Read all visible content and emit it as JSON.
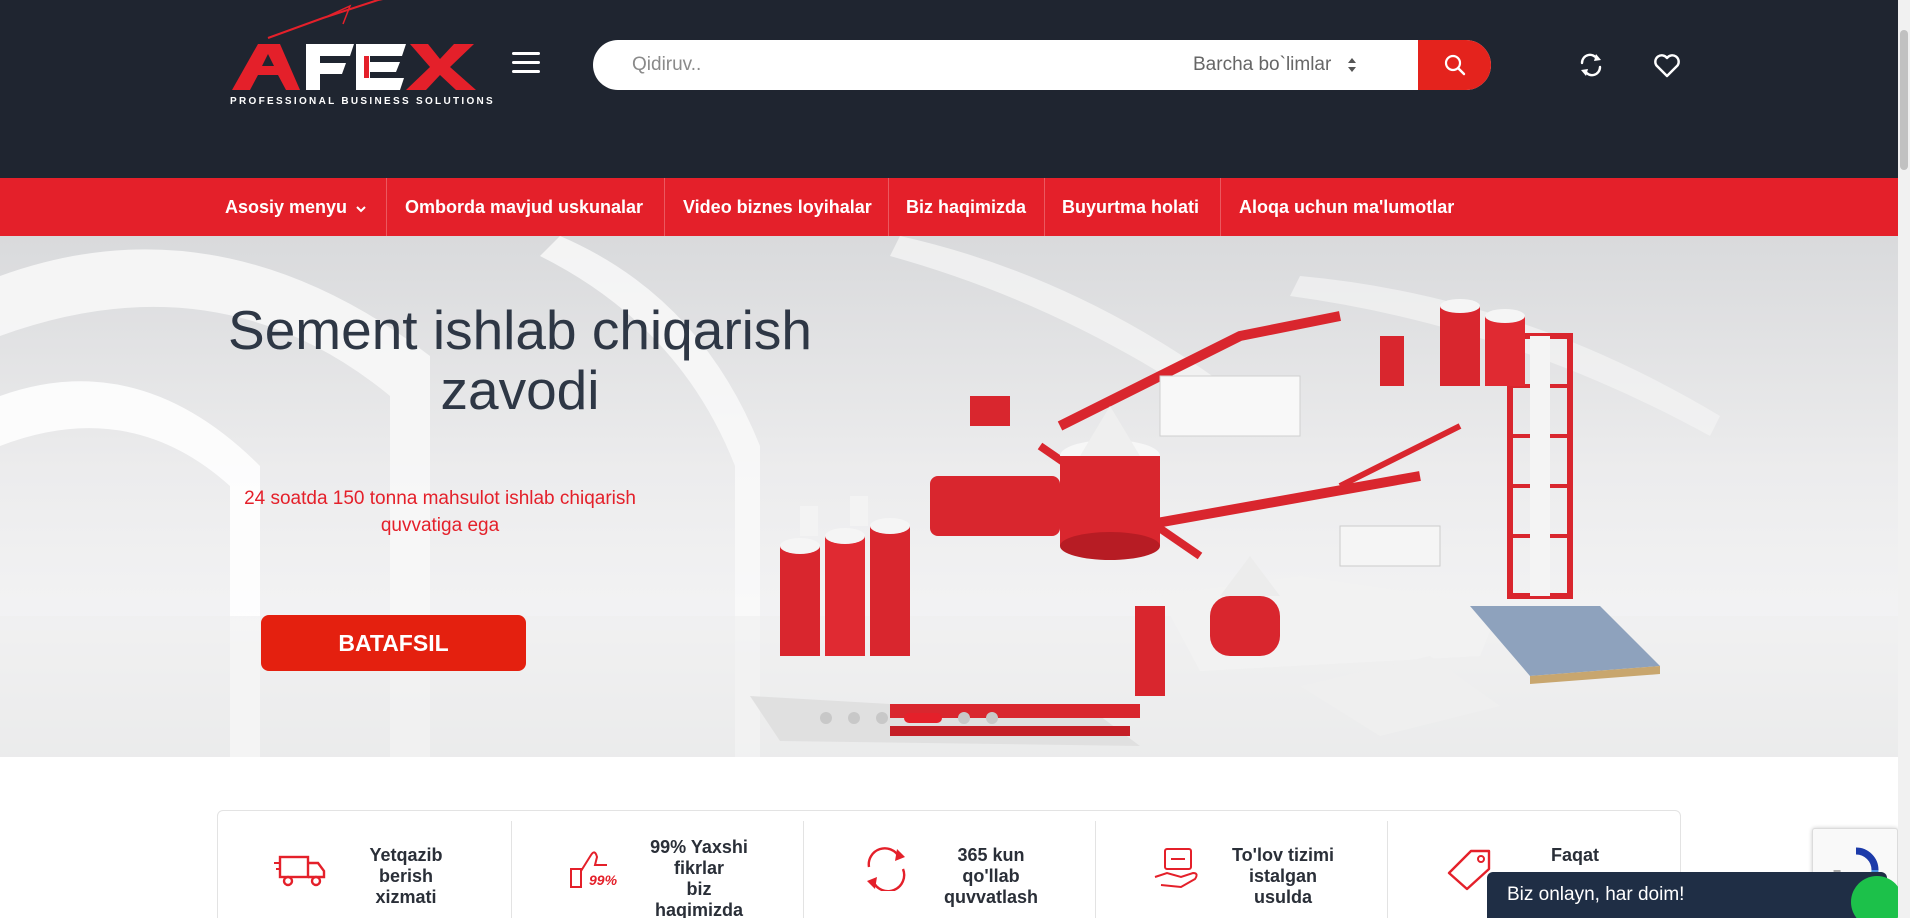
{
  "header": {
    "logo_text": "AFEX",
    "logo_tagline": "PROFESSIONAL BUSINESS SOLUTIONS",
    "search_placeholder": "Qidiruv..",
    "category_select": "Barcha bo`limlar",
    "icons": [
      "menu-icon",
      "search-icon",
      "compare-icon",
      "heart-icon"
    ]
  },
  "nav": {
    "items": [
      {
        "label": "Asosiy menyu",
        "has_dropdown": true
      },
      {
        "label": "Omborda mavjud uskunalar"
      },
      {
        "label": "Video biznes loyihalar"
      },
      {
        "label": "Biz haqimizda"
      },
      {
        "label": "Buyurtma holati"
      },
      {
        "label": "Aloqa uchun ma'lumotlar"
      }
    ]
  },
  "hero": {
    "title_line1": "Sement ishlab chiqarish",
    "title_line2": "zavodi",
    "subtitle_line1": "24 soatda 150 tonna mahsulot ishlab chiqarish",
    "subtitle_line2": "quvvatiga ega",
    "button": "BATAFSIL",
    "slides_count": 6,
    "active_slide": 4
  },
  "features": [
    {
      "icon": "delivery-truck-icon",
      "lines": [
        "Yetqazib",
        "berish",
        "xizmati"
      ]
    },
    {
      "icon": "thumbs-up-icon",
      "badge": "99%",
      "lines": [
        "99% Yaxshi",
        "fikrlar",
        "biz",
        "haqimizda"
      ]
    },
    {
      "icon": "support-cycle-icon",
      "lines": [
        "365 kun",
        "qo'llab",
        "quvvatlash"
      ]
    },
    {
      "icon": "payment-hand-icon",
      "lines": [
        "To'lov tizimi",
        "istalgan",
        "usulda"
      ]
    },
    {
      "icon": "price-tag-icon",
      "lines": [
        "Faqat"
      ]
    }
  ],
  "chat": {
    "label": "Biz onlayn, har doim!"
  },
  "colors": {
    "header_bg": "#1f2530",
    "accent": "#e4202a",
    "text_dark": "#2e3745"
  }
}
